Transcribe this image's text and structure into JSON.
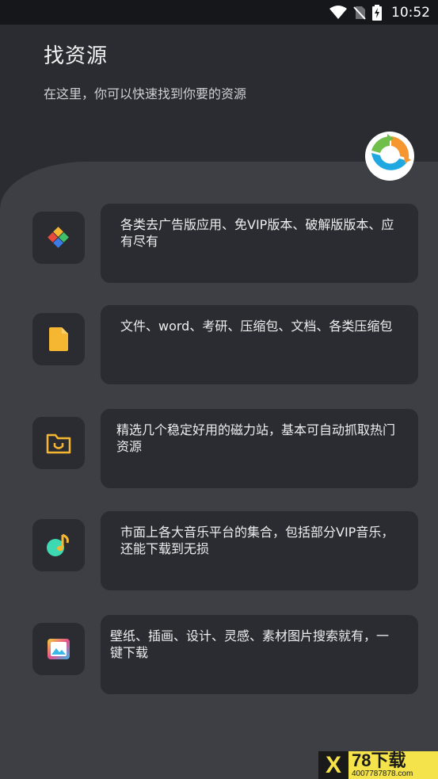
{
  "status_bar": {
    "time": "10:52"
  },
  "header": {
    "title": "找资源",
    "subtitle": "在这里，你可以快速找到你要的资源"
  },
  "items": [
    {
      "icon": "app-blocks-icon",
      "text": "各类去广告版应用、免VIP版本、破解版版本、应有尽有"
    },
    {
      "icon": "document-icon",
      "text": "文件、word、考研、压缩包、文档、各类压缩包"
    },
    {
      "icon": "magnet-folder-icon",
      "text": "精选几个稳定好用的磁力站，基本可自动抓取热门资源"
    },
    {
      "icon": "music-note-icon",
      "text": "市面上各大音乐平台的集合，包括部分VIP音乐，还能下载到无损"
    },
    {
      "icon": "image-icon",
      "text": "壁纸、插画、设计、灵感、素材图片搜索就有，一键下载"
    }
  ],
  "watermark": {
    "brand": "78下载",
    "url": "4007787878.com"
  },
  "colors": {
    "background": "#2a2c31",
    "panel": "#3d3f45",
    "accent_yellow": "#f5b731",
    "accent_green": "#6fbf4a",
    "accent_blue": "#1ea7e1",
    "accent_orange": "#f6962e"
  }
}
